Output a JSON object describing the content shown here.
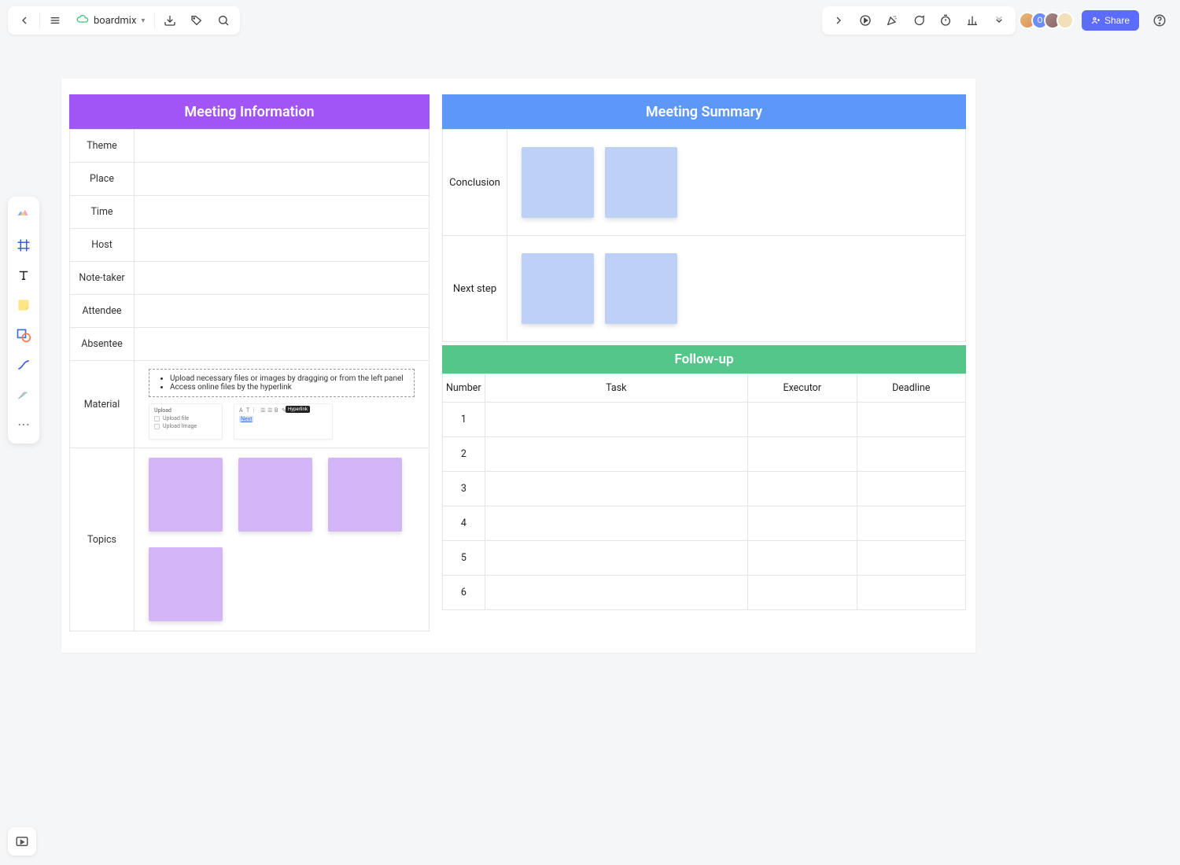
{
  "topbar": {
    "brand": "boardmix",
    "share_label": "Share"
  },
  "meeting_info": {
    "title": "Meeting Information",
    "rows": {
      "theme": "Theme",
      "place": "Place",
      "time": "Time",
      "host": "Host",
      "note_taker": "Note-taker",
      "attendee": "Attendee",
      "absentee": "Absentee",
      "material": "Material",
      "topics": "Topics"
    },
    "material_hints": [
      "Upload necessary files or images by dragging or from the left panel",
      "Access online files by the hyperlink"
    ],
    "thumb_upload_title": "Upload",
    "thumb_upload_file": "Upload file",
    "thumb_upload_image": "Upload Image",
    "thumb_hyperlink_tag": "Hyperlink",
    "thumb_hyperlink_text": "Next"
  },
  "meeting_summary": {
    "title": "Meeting Summary",
    "rows": {
      "conclusion": "Conclusion",
      "next_step": "Next step"
    }
  },
  "followup": {
    "title": "Follow-up",
    "headers": {
      "number": "Number",
      "task": "Task",
      "executor": "Executor",
      "deadline": "Deadline"
    },
    "rows": [
      "1",
      "2",
      "3",
      "4",
      "5",
      "6"
    ]
  }
}
